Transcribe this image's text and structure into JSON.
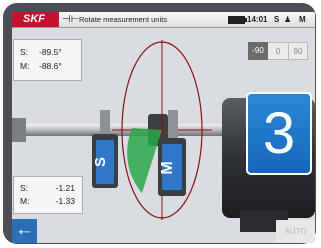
{
  "header": {
    "logo": "SKF",
    "tool_icon": "coupling-icon",
    "title": "Rotate measurement units",
    "time": "14:01",
    "s_label": "S",
    "person_icon": "person-icon",
    "m_label": "M"
  },
  "angles": {
    "s_key": "S:",
    "s_value": "-89.5°",
    "m_key": "M:",
    "m_value": "-88.6°"
  },
  "offsets": {
    "s_key": "S:",
    "s_value": "-1.21",
    "m_key": "M:",
    "m_value": "-1.33"
  },
  "angle_buttons": [
    "-90",
    "0",
    "90"
  ],
  "unit_labels": {
    "s": "S",
    "m": "M"
  },
  "step_number": "3",
  "buttons": {
    "back_icon": "back-arrow-icon",
    "back": "←",
    "auto": "AUTO"
  },
  "colors": {
    "brand_red": "#c8102e",
    "accent_blue": "#1f77c9",
    "sector_green": "#2aa84a",
    "circle_red": "#8b1010"
  }
}
